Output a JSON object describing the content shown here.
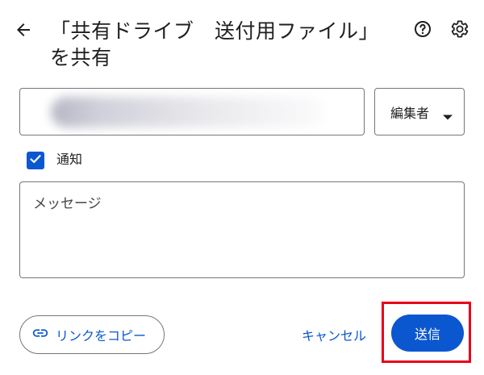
{
  "dialog": {
    "title": "「共有ドライブ　送付用ファイル」を共有",
    "back_icon": "arrow-back-icon",
    "help_icon": "help-circle-icon",
    "settings_icon": "gear-icon"
  },
  "recipients": {
    "value": ""
  },
  "role": {
    "selected": "編集者"
  },
  "notify": {
    "label": "通知",
    "checked": true
  },
  "message": {
    "placeholder": "メッセージ"
  },
  "footer": {
    "copy_link_label": "リンクをコピー",
    "cancel_label": "キャンセル",
    "send_label": "送信"
  },
  "colors": {
    "accent": "#0b57d0",
    "highlight": "#e8001c",
    "border": "#747775"
  }
}
